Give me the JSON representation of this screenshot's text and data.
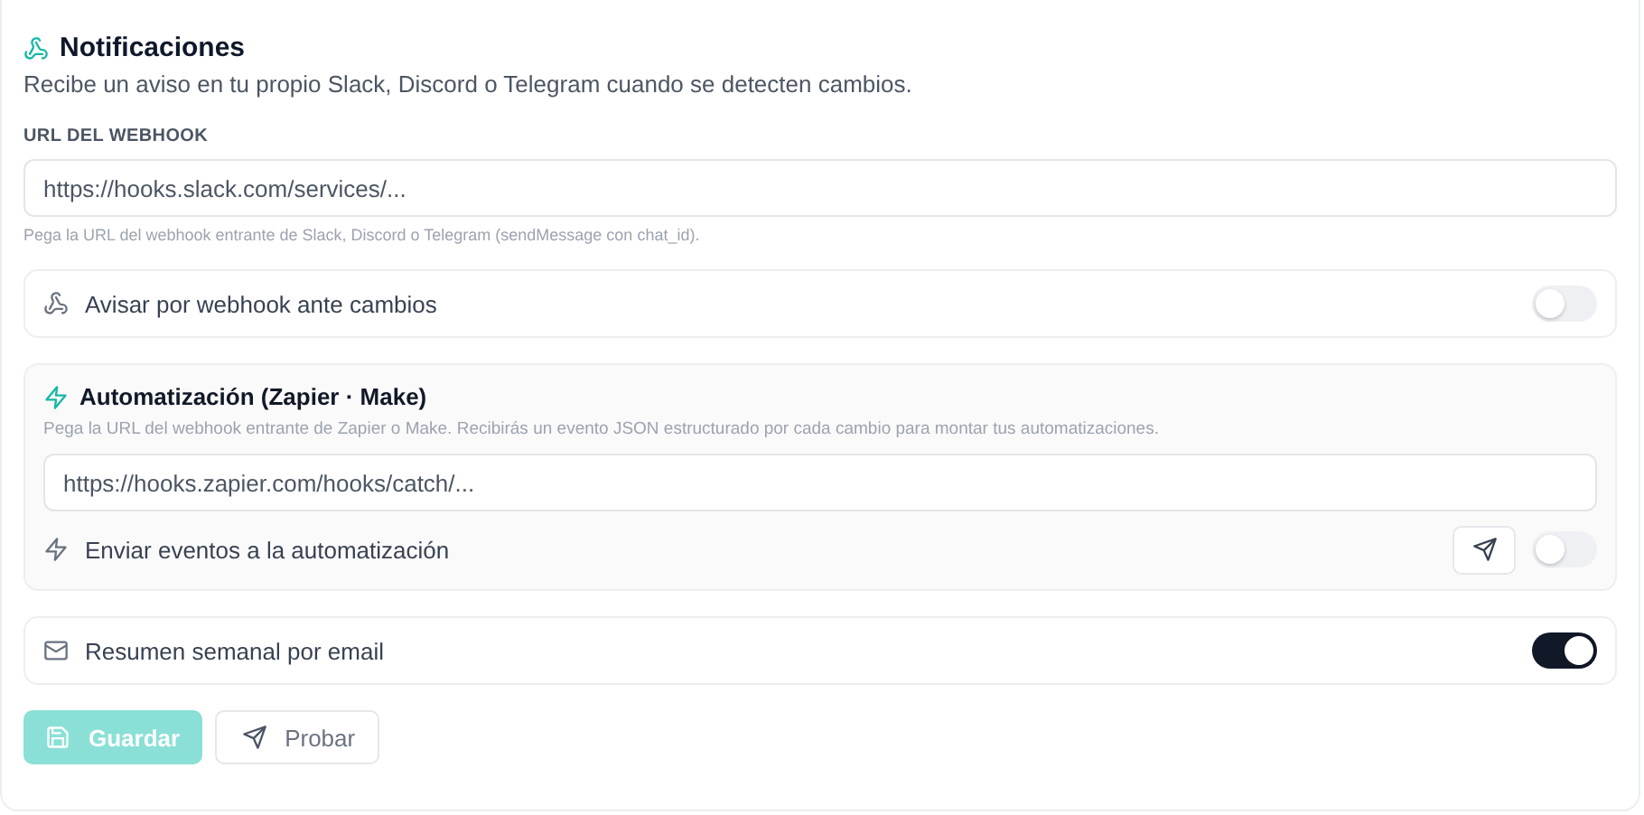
{
  "header": {
    "title": "Notificaciones",
    "subtitle": "Recibe un aviso en tu propio Slack, Discord o Telegram cuando se detecten cambios."
  },
  "webhook": {
    "label": "URL DEL WEBHOOK",
    "placeholder": "https://hooks.slack.com/services/...",
    "hint": "Pega la URL del webhook entrante de Slack, Discord o Telegram (sendMessage con chat_id)."
  },
  "webhook_toggle": {
    "label": "Avisar por webhook ante cambios",
    "on": false
  },
  "automation": {
    "title": "Automatización (Zapier · Make)",
    "description": "Pega la URL del webhook entrante de Zapier o Make. Recibirás un evento JSON estructurado por cada cambio para montar tus automatizaciones.",
    "placeholder": "https://hooks.zapier.com/hooks/catch/...",
    "toggle_label": "Enviar eventos a la automatización",
    "on": false
  },
  "email_toggle": {
    "label": "Resumen semanal por email",
    "on": true
  },
  "buttons": [
    {
      "kind": "save",
      "label": "Guardar",
      "disabled": true
    },
    {
      "kind": "test",
      "label": "Probar",
      "disabled": true
    }
  ]
}
